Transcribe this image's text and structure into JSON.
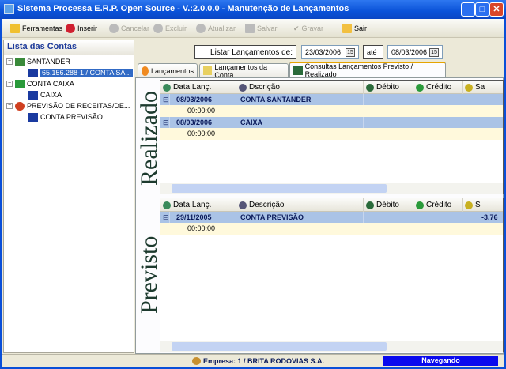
{
  "window": {
    "title": "Sistema Processa E.R.P. Open Source - V.:2.0.0.0 - Manutenção de Lançamentos"
  },
  "toolbar": {
    "ferramentas": "Ferramentas",
    "inserir": "Inserir",
    "cancelar": "Cancelar",
    "excluir": "Excluir",
    "atualizar": "Atualizar",
    "salvar": "Salvar",
    "gravar": "Gravar",
    "sair": "Sair"
  },
  "left": {
    "title": "Lista das Contas",
    "tree": [
      {
        "label": "SANTANDER",
        "children": [
          "65.156.288-1 / CONTA SA..."
        ]
      },
      {
        "label": "CONTA CAIXA",
        "children": [
          "CAIXA"
        ]
      },
      {
        "label": "PREVISÃO DE RECEITAS/DE...",
        "children": [
          "CONTA PREVISÃO"
        ]
      }
    ]
  },
  "filter": {
    "label": "Listar Lançamentos de:",
    "from": "23/03/2006",
    "ate": "até",
    "to": "08/03/2006"
  },
  "tabs": [
    "Lançamentos",
    "Lançamentos da Conta",
    "Consultas Lançamentos Previsto / Realizado"
  ],
  "realizado": {
    "label": "Realizado",
    "columns": [
      "Data Lanç.",
      "Dscrição",
      "Débito",
      "Crédito",
      "Sa"
    ],
    "rows": [
      {
        "date": "08/03/2006",
        "desc": "CONTA SANTANDER",
        "time": "00:00:00"
      },
      {
        "date": "08/03/2006",
        "desc": "CAIXA",
        "time": "00:00:00"
      }
    ]
  },
  "previsto": {
    "label": "Previsto",
    "columns": [
      "Data Lanç.",
      "Descrição",
      "Débito",
      "Crédito",
      "S"
    ],
    "rows": [
      {
        "date": "29/11/2005",
        "desc": "CONTA PREVISÃO",
        "saldo": "-3.76",
        "time": "00:00:00"
      }
    ]
  },
  "status": {
    "empresa": "Empresa: 1 / BRITA RODOVIAS S.A.",
    "mode": "Navegando"
  }
}
